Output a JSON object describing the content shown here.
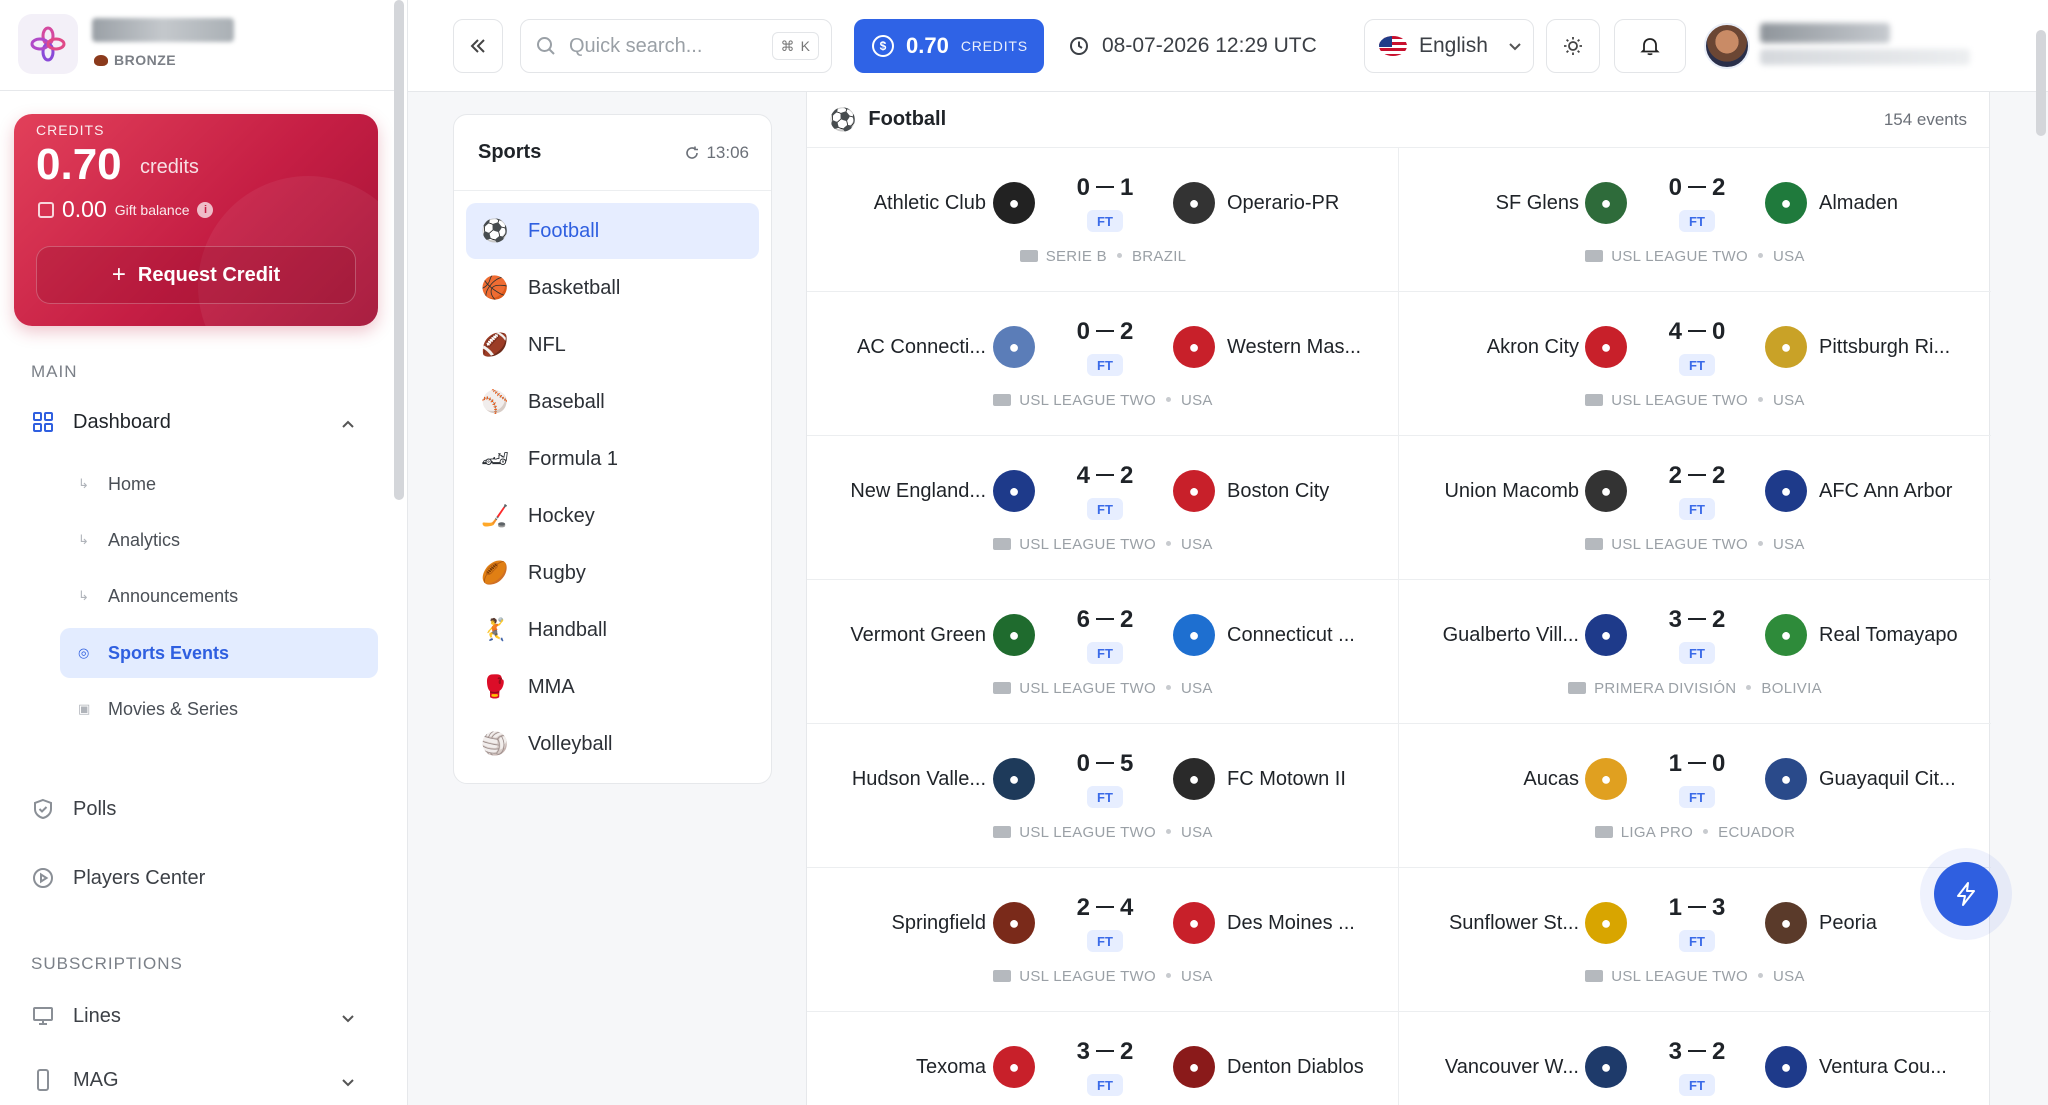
{
  "user": {
    "tier": "BRONZE"
  },
  "credit_card": {
    "label": "CREDITS",
    "amount": "0.70",
    "unit": "credits",
    "gift_amount": "0.00",
    "gift_label": "Gift balance",
    "button": "Request Credit"
  },
  "sidebar": {
    "main_label": "MAIN",
    "dashboard": "Dashboard",
    "sub_items": [
      "Home",
      "Analytics",
      "Announcements",
      "Sports Events",
      "Movies & Series"
    ],
    "polls": "Polls",
    "players": "Players Center",
    "subs_label": "SUBSCRIPTIONS",
    "lines": "Lines",
    "mag": "MAG"
  },
  "header": {
    "search_placeholder": "Quick search...",
    "search_kbd": "K",
    "credits_value": "0.70",
    "credits_label": "CREDITS",
    "datetime": "08-07-2026 12:29 UTC",
    "language": "English"
  },
  "sports": {
    "title": "Sports",
    "time": "13:06",
    "items": [
      "Football",
      "Basketball",
      "NFL",
      "Baseball",
      "Formula 1",
      "Hockey",
      "Rugby",
      "Handball",
      "MMA",
      "Volleyball"
    ],
    "icons": [
      "⚽",
      "🏀",
      "🏈",
      "⚾",
      "🏎",
      "🏒",
      "🏉",
      "🤾",
      "🥊",
      "🏐"
    ]
  },
  "events": {
    "title": "Football",
    "count": "154 events",
    "matches": [
      {
        "home": "Athletic Club",
        "hs": "0",
        "as": "1",
        "status": "FT",
        "away": "Operario-PR",
        "league": "SERIE B",
        "country": "BRAZIL",
        "hc": "#222",
        "ac": "#333"
      },
      {
        "home": "SF Glens",
        "hs": "0",
        "as": "2",
        "status": "FT",
        "away": "Almaden",
        "league": "USL LEAGUE TWO",
        "country": "USA",
        "hc": "#2e6b3a",
        "ac": "#1f7a3c"
      },
      {
        "home": "AC Connecti...",
        "hs": "0",
        "as": "2",
        "status": "FT",
        "away": "Western Mas...",
        "league": "USL LEAGUE TWO",
        "country": "USA",
        "hc": "#5b7db8",
        "ac": "#c8202a"
      },
      {
        "home": "Akron City",
        "hs": "4",
        "as": "0",
        "status": "FT",
        "away": "Pittsburgh Ri...",
        "league": "USL LEAGUE TWO",
        "country": "USA",
        "hc": "#c8202a",
        "ac": "#c9a227"
      },
      {
        "home": "New England...",
        "hs": "4",
        "as": "2",
        "status": "FT",
        "away": "Boston City",
        "league": "USL LEAGUE TWO",
        "country": "USA",
        "hc": "#1e3a8a",
        "ac": "#c8202a"
      },
      {
        "home": "Union Macomb",
        "hs": "2",
        "as": "2",
        "status": "FT",
        "away": "AFC Ann Arbor",
        "league": "USL LEAGUE TWO",
        "country": "USA",
        "hc": "#333",
        "ac": "#1e3a8a"
      },
      {
        "home": "Vermont Green",
        "hs": "6",
        "as": "2",
        "status": "FT",
        "away": "Connecticut ...",
        "league": "USL LEAGUE TWO",
        "country": "USA",
        "hc": "#1f6b2e",
        "ac": "#1e6fd0"
      },
      {
        "home": "Gualberto Vill...",
        "hs": "3",
        "as": "2",
        "status": "FT",
        "away": "Real Tomayapo",
        "league": "PRIMERA DIVISIÓN",
        "country": "BOLIVIA",
        "hc": "#1e3a8a",
        "ac": "#2e8b3a"
      },
      {
        "home": "Hudson Valle...",
        "hs": "0",
        "as": "5",
        "status": "FT",
        "away": "FC Motown II",
        "league": "USL LEAGUE TWO",
        "country": "USA",
        "hc": "#1e3a5a",
        "ac": "#2a2a2a"
      },
      {
        "home": "Aucas",
        "hs": "1",
        "as": "0",
        "status": "FT",
        "away": "Guayaquil Cit...",
        "league": "LIGA PRO",
        "country": "ECUADOR",
        "hc": "#e0a020",
        "ac": "#2a4a8a"
      },
      {
        "home": "Springfield",
        "hs": "2",
        "as": "4",
        "status": "FT",
        "away": "Des Moines ...",
        "league": "USL LEAGUE TWO",
        "country": "USA",
        "hc": "#7a2a1a",
        "ac": "#c8202a"
      },
      {
        "home": "Sunflower St...",
        "hs": "1",
        "as": "3",
        "status": "FT",
        "away": "Peoria",
        "league": "USL LEAGUE TWO",
        "country": "USA",
        "hc": "#d8a500",
        "ac": "#5a3a2a"
      },
      {
        "home": "Texoma",
        "hs": "3",
        "as": "2",
        "status": "FT",
        "away": "Denton Diablos",
        "league": "",
        "country": "",
        "hc": "#c8202a",
        "ac": "#8a1a1a"
      },
      {
        "home": "Vancouver W...",
        "hs": "3",
        "as": "2",
        "status": "FT",
        "away": "Ventura Cou...",
        "league": "",
        "country": "",
        "hc": "#1e3a6a",
        "ac": "#1e3a8a"
      }
    ]
  }
}
